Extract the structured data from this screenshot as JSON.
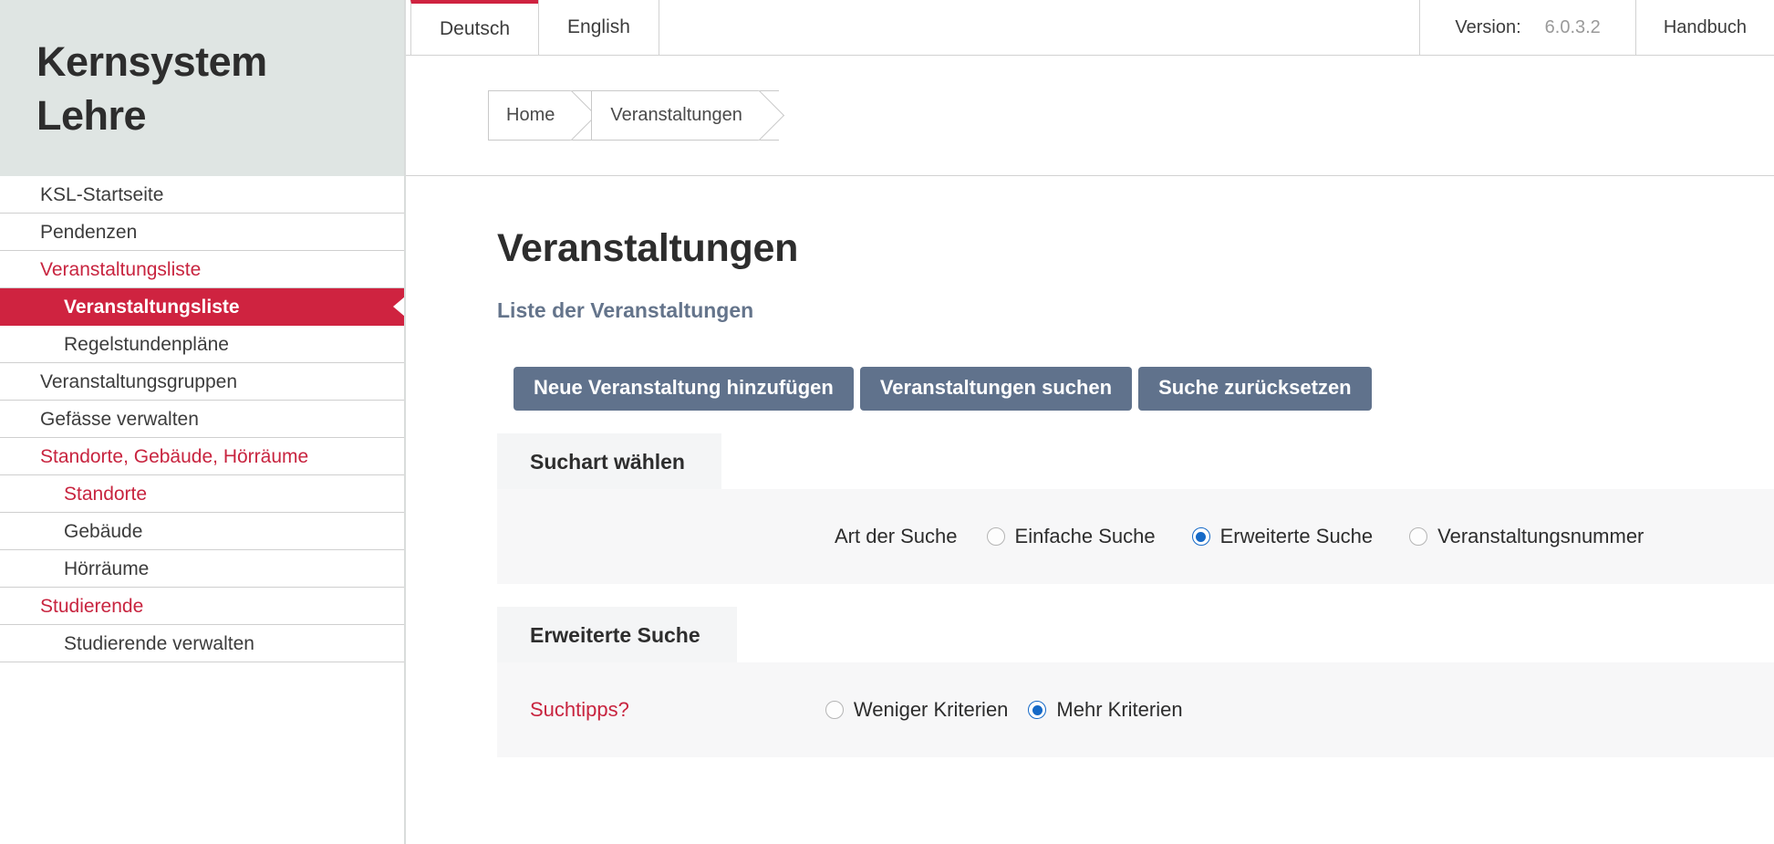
{
  "sidebar": {
    "brand_line1": "Kernsystem",
    "brand_line2": "Lehre",
    "items": [
      {
        "label": "KSL-Startseite",
        "level": 1,
        "style": "normal"
      },
      {
        "label": "Pendenzen",
        "level": 1,
        "style": "normal"
      },
      {
        "label": "Veranstaltungsliste",
        "level": 1,
        "style": "red"
      },
      {
        "label": "Veranstaltungsliste",
        "level": 2,
        "style": "active"
      },
      {
        "label": "Regelstundenpläne",
        "level": 2,
        "style": "normal"
      },
      {
        "label": "Veranstaltungsgruppen",
        "level": 1,
        "style": "normal"
      },
      {
        "label": "Gefässe verwalten",
        "level": 1,
        "style": "normal"
      },
      {
        "label": "Standorte, Gebäude, Hörräume",
        "level": 1,
        "style": "red"
      },
      {
        "label": "Standorte",
        "level": 2,
        "style": "red"
      },
      {
        "label": "Gebäude",
        "level": 2,
        "style": "normal"
      },
      {
        "label": "Hörräume",
        "level": 2,
        "style": "normal"
      },
      {
        "label": "Studierende",
        "level": 1,
        "style": "red"
      },
      {
        "label": "Studierende verwalten",
        "level": 2,
        "style": "normal"
      }
    ]
  },
  "topbar": {
    "tabs": [
      {
        "label": "Deutsch",
        "active": true
      },
      {
        "label": "English",
        "active": false
      }
    ],
    "version_label": "Version:",
    "version_value": "6.0.3.2",
    "handbuch_label": "Handbuch"
  },
  "breadcrumb": {
    "items": [
      {
        "label": "Home"
      },
      {
        "label": "Veranstaltungen"
      }
    ]
  },
  "page": {
    "title": "Veranstaltungen",
    "subtitle": "Liste der Veranstaltungen"
  },
  "buttons": [
    {
      "label": "Neue Veranstaltung hinzufügen"
    },
    {
      "label": "Veranstaltungen suchen"
    },
    {
      "label": "Suche zurücksetzen"
    }
  ],
  "search_type_panel": {
    "tab_label": "Suchart wählen",
    "field_label": "Art der Suche",
    "options": [
      {
        "label": "Einfache Suche",
        "checked": false
      },
      {
        "label": "Erweiterte Suche",
        "checked": true
      },
      {
        "label": "Veranstaltungsnummer",
        "checked": false
      }
    ]
  },
  "advanced_panel": {
    "tab_label": "Erweiterte Suche",
    "tips_label": "Suchtipps?",
    "criteria_options": [
      {
        "label": "Weniger Kriterien",
        "checked": false
      },
      {
        "label": "Mehr Kriterien",
        "checked": true
      }
    ]
  },
  "colors": {
    "accent_red": "#cf2340",
    "link_red": "#c8243f",
    "brand_bg": "#dfe5e3",
    "button_slate": "#60728c",
    "subtitle_slate": "#64748b",
    "radio_blue": "#1569c7"
  }
}
